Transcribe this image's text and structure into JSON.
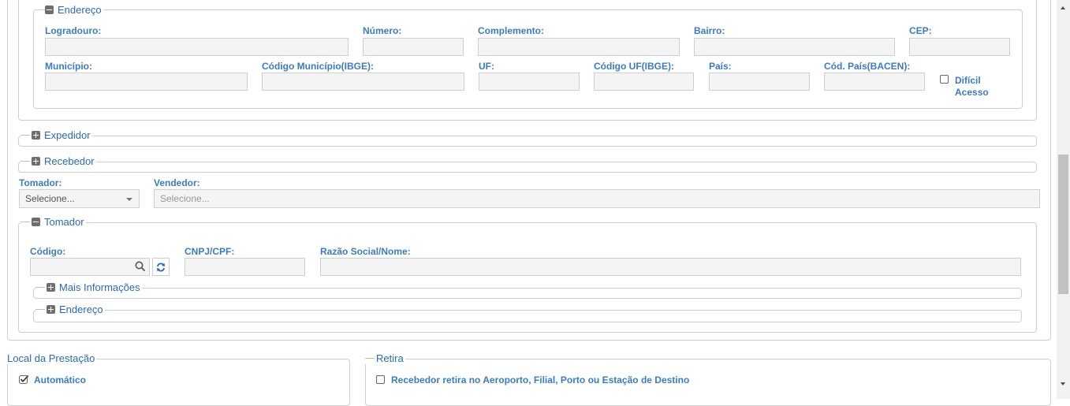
{
  "remetente_endereco": {
    "legend": "Endereço",
    "logradouro_label": "Logradouro:",
    "numero_label": "Número:",
    "complemento_label": "Complemento:",
    "bairro_label": "Bairro:",
    "cep_label": "CEP:",
    "municipio_label": "Município:",
    "codigo_municipio_label": "Código Município(IBGE):",
    "uf_label": "UF:",
    "codigo_uf_label": "Código UF(IBGE):",
    "pais_label": "País:",
    "cod_pais_label": "Cód. País(BACEN):",
    "dificil_acesso_label_1": "Difícil",
    "dificil_acesso_label_2": "Acesso"
  },
  "expedidor": {
    "legend": "Expedidor"
  },
  "recebedor": {
    "legend": "Recebedor"
  },
  "tomador_select": {
    "label": "Tomador:",
    "value": "Selecione..."
  },
  "vendedor_select": {
    "label": "Vendedor:",
    "value": "Selecione..."
  },
  "tomador": {
    "legend": "Tomador",
    "codigo_label": "Código:",
    "cnpj_label": "CNPJ/CPF:",
    "razao_label": "Razão Social/Nome:",
    "mais_info_legend": "Mais Informações",
    "endereco_legend": "Endereço"
  },
  "local_prestacao": {
    "legend": "Local da Prestação",
    "automatico_label": "Automático",
    "automatico_checked": true
  },
  "retira": {
    "legend": "Retira",
    "option_label": "Recebedor retira no Aeroporto, Filial, Porto ou Estação de Destino",
    "checked": false
  },
  "colors": {
    "accent": "#2a6ab5",
    "label": "#3a7cc4",
    "input_bg": "#f4f4f4",
    "border": "#cfcfcf"
  },
  "icons": {
    "collapse": "minus-square-icon",
    "expand": "plus-square-icon",
    "search": "search-icon",
    "refresh": "refresh-icon"
  }
}
